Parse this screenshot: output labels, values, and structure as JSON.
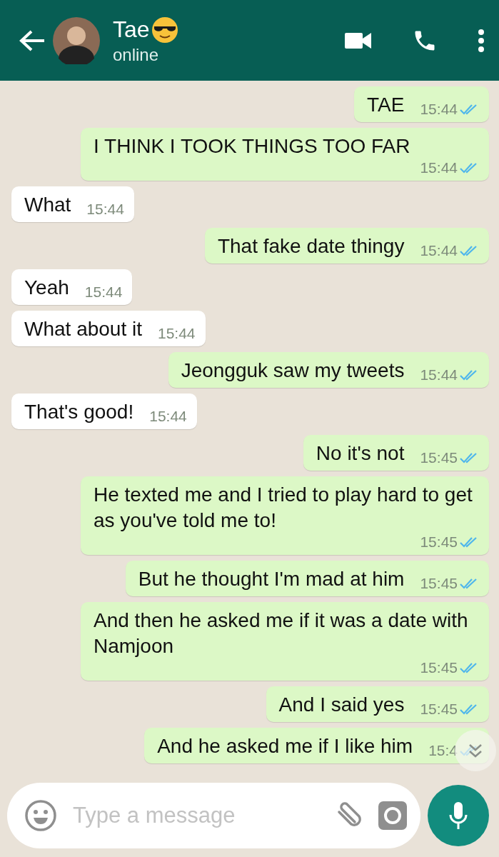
{
  "header": {
    "name": "Tae",
    "status": "online"
  },
  "messages": [
    {
      "kind": "sent",
      "text": "TAE",
      "time": "15:44",
      "read": true
    },
    {
      "kind": "sent",
      "text": "I THINK I TOOK THINGS TOO FAR",
      "time": "15:44",
      "read": true
    },
    {
      "kind": "received",
      "text": "What",
      "time": "15:44"
    },
    {
      "kind": "sent",
      "text": "That fake date thingy",
      "time": "15:44",
      "read": true
    },
    {
      "kind": "received",
      "text": "Yeah",
      "time": "15:44"
    },
    {
      "kind": "received",
      "text": "What about it",
      "time": "15:44"
    },
    {
      "kind": "sent",
      "text": "Jeongguk saw my tweets",
      "time": "15:44",
      "read": true
    },
    {
      "kind": "received",
      "text": "That's good!",
      "time": "15:44"
    },
    {
      "kind": "sent",
      "text": "No it's not",
      "time": "15:45",
      "read": true
    },
    {
      "kind": "sent",
      "text": "He texted me and I tried to play hard to get as you've told me to!",
      "time": "15:45",
      "read": true
    },
    {
      "kind": "sent",
      "text": "But he thought I'm mad at him",
      "time": "15:45",
      "read": true
    },
    {
      "kind": "sent",
      "text": "And then he asked me if it was a date with Namjoon",
      "time": "15:45",
      "read": true
    },
    {
      "kind": "sent",
      "text": "And I said yes",
      "time": "15:45",
      "read": true
    },
    {
      "kind": "sent",
      "text": "And he asked me if I like him",
      "time": "15:4",
      "read": true
    }
  ],
  "composer": {
    "placeholder": "Type a message"
  }
}
